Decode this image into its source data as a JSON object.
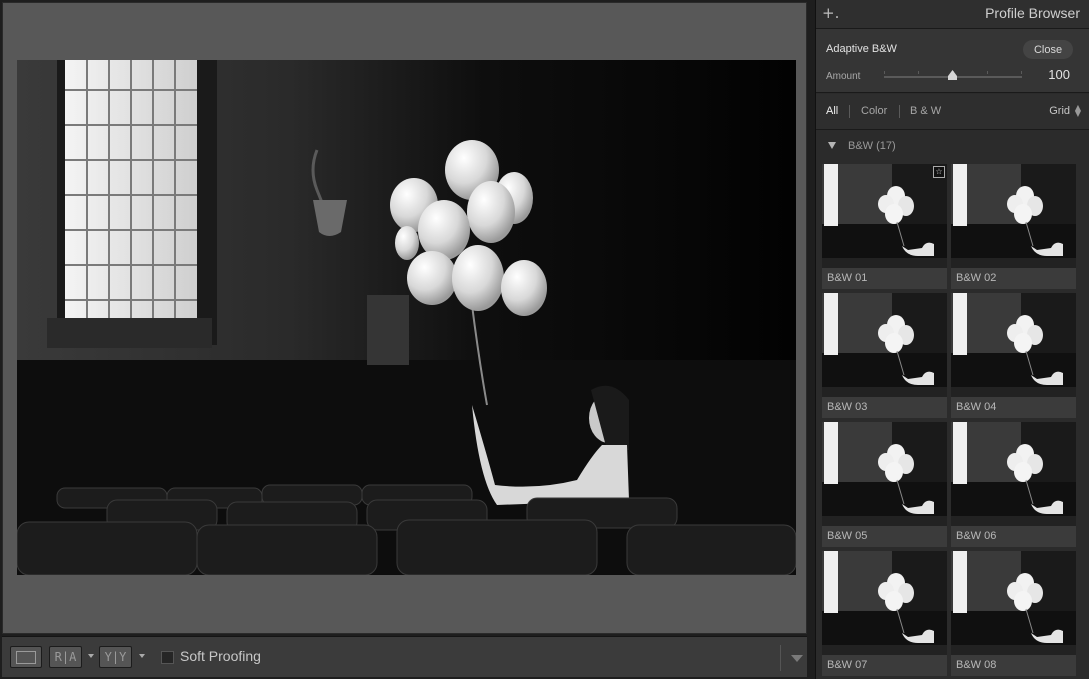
{
  "panel": {
    "title": "Profile Browser",
    "add_icon": "plus-icon",
    "profile_name": "Adaptive B&W",
    "close_label": "Close",
    "amount_label": "Amount",
    "amount_value": "100",
    "amount_fraction": 0.5,
    "filters": [
      "All",
      "Color",
      "B & W"
    ],
    "active_filter": "All",
    "view_mode": "Grid",
    "group_label": "B&W (17)"
  },
  "thumbnails": [
    {
      "label": "B&W 01",
      "favorite": true
    },
    {
      "label": "B&W 02",
      "favorite": false
    },
    {
      "label": "B&W 03",
      "favorite": false
    },
    {
      "label": "B&W 04",
      "favorite": false
    },
    {
      "label": "B&W 05",
      "favorite": false
    },
    {
      "label": "B&W 06",
      "favorite": false
    },
    {
      "label": "B&W 07",
      "favorite": false
    },
    {
      "label": "B&W 08",
      "favorite": false
    }
  ],
  "toolbar": {
    "compare_ra": "R|A",
    "compare_yy": "Y|Y",
    "soft_proofing_label": "Soft Proofing",
    "soft_proofing_checked": false
  },
  "colors": {
    "panel_bg": "#2b2b2b",
    "canvas_bg": "#585858",
    "toolbar_bg": "#3b3b3b"
  }
}
